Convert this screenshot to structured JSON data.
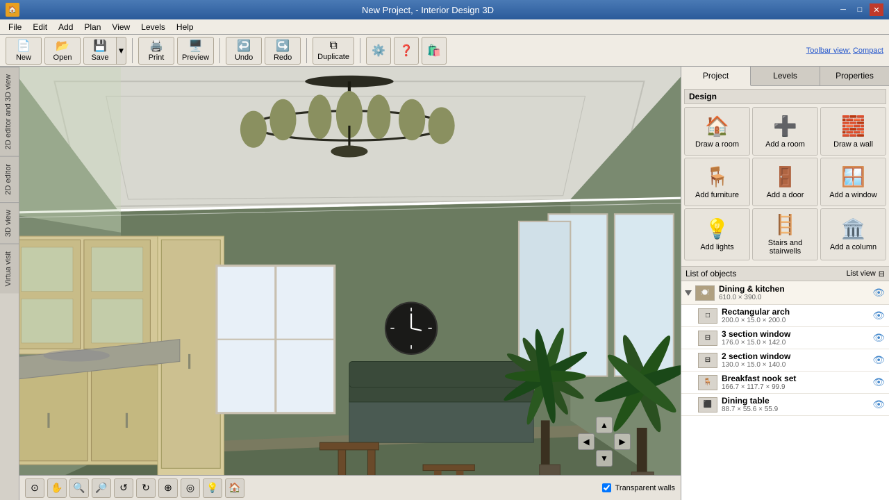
{
  "titlebar": {
    "title": "New Project, - Interior Design 3D",
    "minimize": "─",
    "restore": "□",
    "close": "✕"
  },
  "menubar": {
    "items": [
      "File",
      "Edit",
      "Add",
      "Plan",
      "View",
      "Levels",
      "Help"
    ]
  },
  "toolbar": {
    "new_label": "New",
    "open_label": "Open",
    "save_label": "Save",
    "print_label": "Print",
    "preview_label": "Preview",
    "undo_label": "Undo",
    "redo_label": "Redo",
    "duplicate_label": "Duplicate",
    "toolbar_view_text": "Toolbar view:",
    "compact_label": "Compact"
  },
  "left_tabs": [
    "2D editor and 3D view",
    "2D editor",
    "3D view",
    "Virtua visit"
  ],
  "right_panel": {
    "tabs": [
      "Project",
      "Levels",
      "Properties"
    ],
    "active_tab": "Project",
    "design_label": "Design",
    "design_buttons": [
      {
        "label": "Draw a room",
        "icon": "🏠"
      },
      {
        "label": "Add a room",
        "icon": "➕"
      },
      {
        "label": "Draw a wall",
        "icon": "🧱"
      },
      {
        "label": "Add furniture",
        "icon": "🪑"
      },
      {
        "label": "Add a door",
        "icon": "🚪"
      },
      {
        "label": "Add a window",
        "icon": "🪟"
      },
      {
        "label": "Add lights",
        "icon": "💡"
      },
      {
        "label": "Stairs and stairwells",
        "icon": "🪜"
      },
      {
        "label": "Add a column",
        "icon": "🏛️"
      }
    ],
    "objects_list_label": "List of objects",
    "list_view_label": "List view",
    "objects": [
      {
        "type": "group",
        "name": "Dining & kitchen",
        "dims": "610.0 × 390.0",
        "is_expanded": true
      },
      {
        "type": "item",
        "name": "Rectangular arch",
        "dims": "200.0 × 15.0 × 200.0"
      },
      {
        "type": "item",
        "name": "3 section window",
        "dims": "176.0 × 15.0 × 142.0"
      },
      {
        "type": "item",
        "name": "2 section window",
        "dims": "130.0 × 15.0 × 140.0"
      },
      {
        "type": "item",
        "name": "Breakfast nook set",
        "dims": "166.7 × 117.7 × 99.9"
      },
      {
        "type": "item",
        "name": "Dining table",
        "dims": "88.7 × 55.6 × 55.9"
      }
    ]
  },
  "viewport": {
    "transparent_walls_label": "Transparent walls",
    "transparent_walls_checked": true
  }
}
